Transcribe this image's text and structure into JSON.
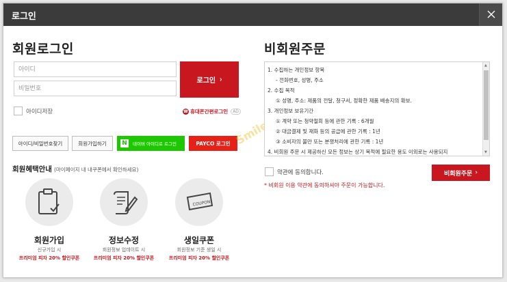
{
  "window": {
    "title": "로그인"
  },
  "member": {
    "heading": "회원로그인",
    "id_placeholder": "아이디",
    "pw_placeholder": "비밀번호",
    "login_label": "로그인",
    "save_id_label": "아이디저장",
    "phone_login_label": "휴대폰간편로그인",
    "ad_label": "AD",
    "find_label": "아이디/비밀번호찾기",
    "join_label": "회원가입하기",
    "naver_label": "네이버 아이디로 로그인",
    "payco_label": "PAYCO 로그인",
    "benefit_title": "회원혜택안내",
    "benefit_note": "(마이페이지 내 내쿠폰에서 확인하세요)",
    "benefits": [
      {
        "name": "회원가입",
        "desc": "신규가입 시",
        "promo": "프리미엄 피자 20% 할인쿠폰",
        "icon": "clipboard-check-icon"
      },
      {
        "name": "정보수정",
        "desc": "회원정보 업데이트 시",
        "promo": "프리미엄 피자 20% 할인쿠폰",
        "icon": "document-pen-icon"
      },
      {
        "name": "생일쿠폰",
        "desc": "회원정보 기준 생일 시",
        "promo": "프리미엄 피자 20% 할인쿠폰",
        "icon": "coupon-icon"
      }
    ]
  },
  "guest": {
    "heading": "비회원주문",
    "terms": [
      "1.   수집하는 개인정보 항목",
      "- 전화번호, 성명, 주소",
      "2.   수집 목적",
      "① 성명, 주소: 제품의 전달, 청구서, 정확한 제품 배송지의 확보.",
      "3.   개인정보 보유기간",
      "① 계약 또는 청약철회 등에 관한 기록 : 6개월",
      "② 대금결제 및 재화 등의 공급에 관한 기록 : 1년",
      "③ 소비자의 불만 또는 분쟁처리에 관한 기록 : 1년",
      "4.   비회원 주문 시 제공하신 모든 정보는 상기 목적에 필요한 용도 이외로는 사용되지"
    ],
    "agree_label": "약관에 동의합니다.",
    "order_label": "비회원주문",
    "warning": "* 비회원 이용 약관에 동의하셔야 주문이 가능합니다."
  },
  "watermark": "Smile",
  "colors": {
    "accent": "#c8171e",
    "naver": "#1ec800",
    "payco": "#e62117",
    "titlebar": "#3b3b3b"
  }
}
